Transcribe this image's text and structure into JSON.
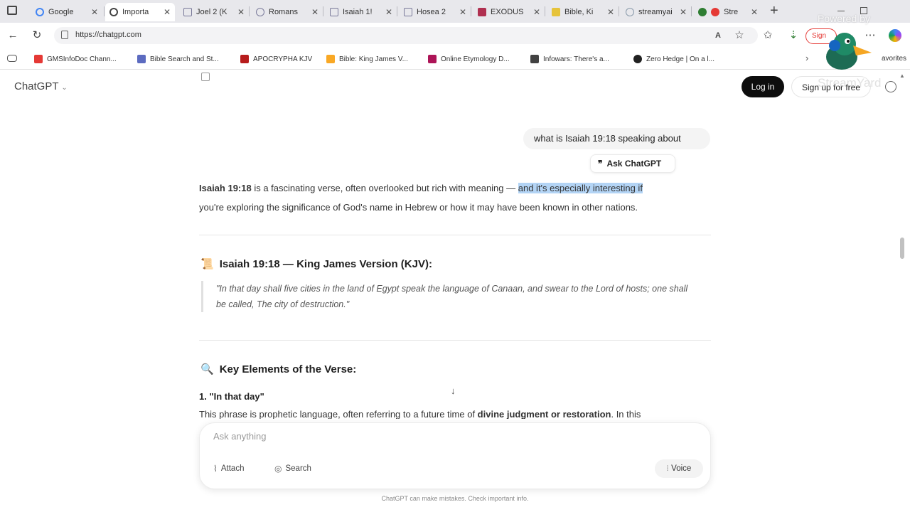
{
  "browser": {
    "tabs": [
      {
        "label": "Google",
        "color": "#4285f4"
      },
      {
        "label": "Importa",
        "color": "#555555"
      },
      {
        "label": "Joel 2 (K",
        "color": "#7a7a9a"
      },
      {
        "label": "Romans",
        "color": "#7a7a9a"
      },
      {
        "label": "Isaiah 1!",
        "color": "#7a7a9a"
      },
      {
        "label": "Hosea 2",
        "color": "#7a7a9a"
      },
      {
        "label": "EXODUS",
        "color": "#b03050"
      },
      {
        "label": "Bible, Ki",
        "color": "#e6c33a"
      },
      {
        "label": "streamyai",
        "color": "#8899aa"
      },
      {
        "label": "Stre",
        "color": "#e53935"
      }
    ],
    "new_tab": "+",
    "url": "https://chatgpt.com",
    "bookmarks": [
      {
        "label": "GMSInfoDoc Chann...",
        "color": "#e53935"
      },
      {
        "label": "Bible Search and St...",
        "color": "#5c6bc0"
      },
      {
        "label": "APOCRYPHA KJV",
        "color": "#b71c1c"
      },
      {
        "label": "Bible: King James V...",
        "color": "#f9a825"
      },
      {
        "label": "Online Etymology D...",
        "color": "#ad1457"
      },
      {
        "label": "Infowars: There's a...",
        "color": "#424242"
      },
      {
        "label": "Zero Hedge | On a l...",
        "color": "#212121"
      }
    ],
    "favorites_label": "avorites",
    "sign_in_label": "Sign"
  },
  "header": {
    "brand": "ChatGPT",
    "login": "Log in",
    "signup": "Sign up for free"
  },
  "chat": {
    "user_message": "what is Isaiah 19:18 speaking about",
    "ask_chatgpt": "Ask ChatGPT",
    "intro_bold": "Isaiah 19:18",
    "intro_text": " is a fascinating verse, often overlooked but rich with meaning — ",
    "intro_highlight": "and it's especially interesting if",
    "intro_line2": "you're exploring the significance of God's name in Hebrew or how it may have been known in other nations.",
    "section1_title": "Isaiah 19:18 — King James Version (KJV):",
    "section1_icon": "📜",
    "quote": "\"In that day shall five cities in the land of Egypt speak the language of Canaan, and swear to the Lord of hosts; one shall be called, The city of destruction.\"",
    "section2_title": "Key Elements of the Verse:",
    "section2_icon": "🔍",
    "item1_title": "1. \"In that day\"",
    "item1_text": "This phrase is prophetic language, often referring to a future time of ",
    "item1_bold": "divine judgment or restoration",
    "item1_tail": ". In this"
  },
  "composer": {
    "placeholder": "Ask anything",
    "attach": "Attach",
    "search": "Search",
    "voice": "Voice"
  },
  "disclaimer": "ChatGPT can make mistakes. Check important info.",
  "watermark": {
    "line1": "Powered by",
    "line2": "StreamYard"
  }
}
